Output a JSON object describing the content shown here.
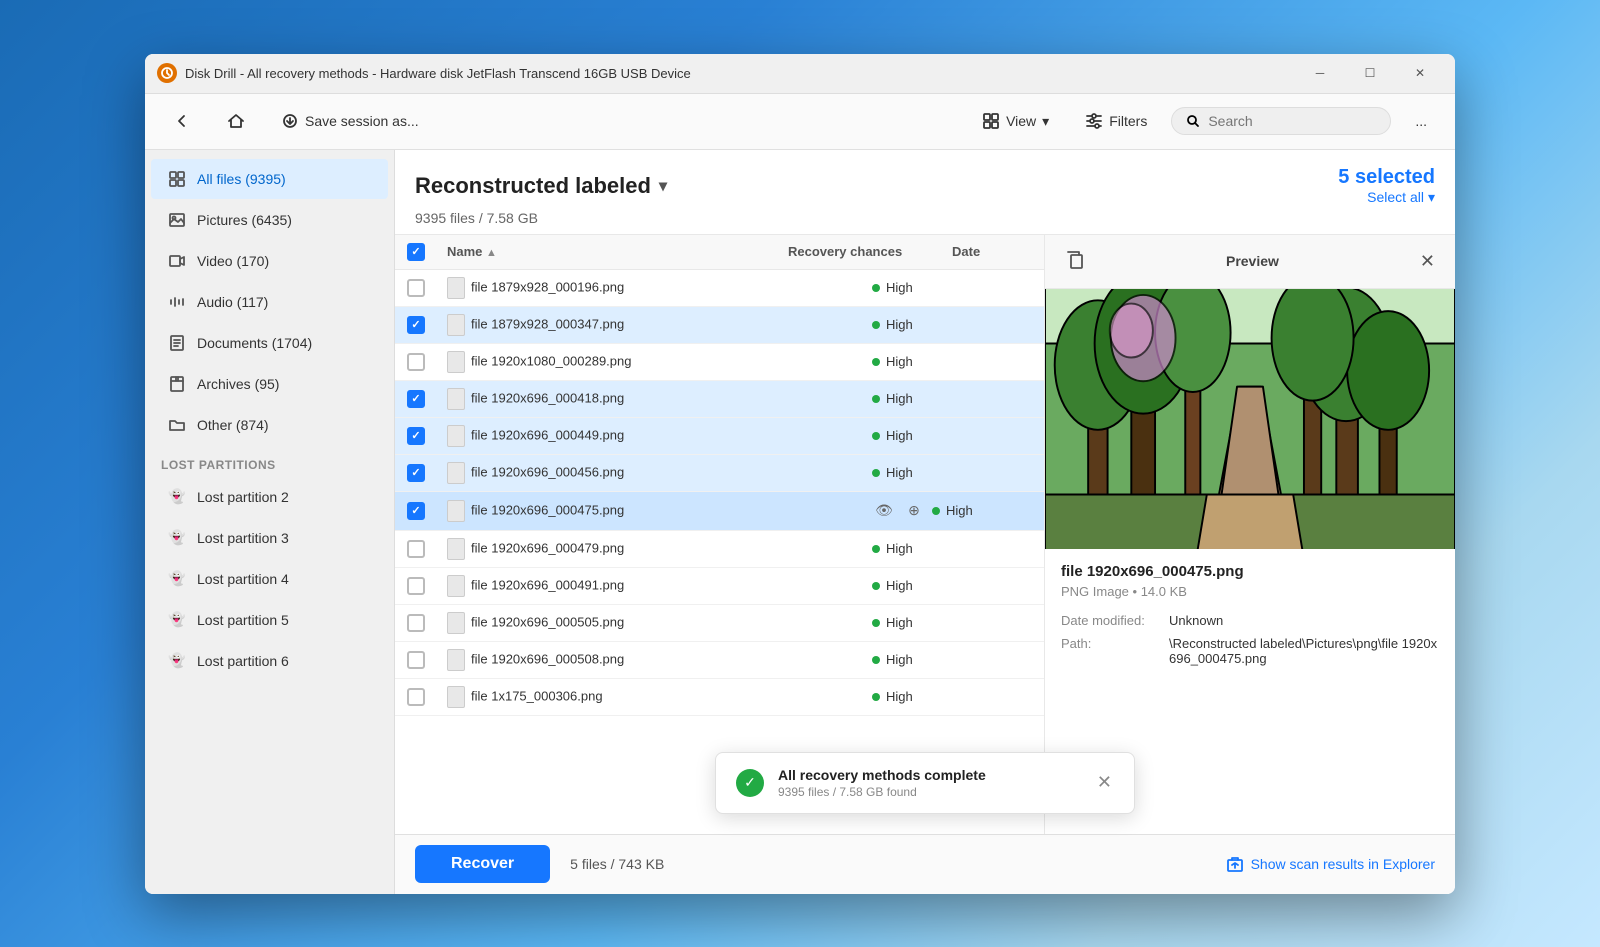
{
  "window": {
    "title": "Disk Drill - All recovery methods - Hardware disk JetFlash Transcend 16GB USB Device",
    "icon_label": "D"
  },
  "toolbar": {
    "back_label": "",
    "home_label": "",
    "save_session_label": "Save session as...",
    "view_label": "View",
    "filters_label": "Filters",
    "search_placeholder": "Search",
    "more_label": "..."
  },
  "sidebar": {
    "items": [
      {
        "label": "All files (9395)",
        "icon": "grid"
      },
      {
        "label": "Pictures (6435)",
        "icon": "pictures"
      },
      {
        "label": "Video (170)",
        "icon": "video"
      },
      {
        "label": "Audio (117)",
        "icon": "audio"
      },
      {
        "label": "Documents (1704)",
        "icon": "documents"
      },
      {
        "label": "Archives (95)",
        "icon": "archives"
      },
      {
        "label": "Other (874)",
        "icon": "other"
      }
    ],
    "lost_partitions_label": "Lost partitions",
    "lost_partitions": [
      {
        "label": "Lost partition 2"
      },
      {
        "label": "Lost partition 3"
      },
      {
        "label": "Lost partition 4"
      },
      {
        "label": "Lost partition 5"
      },
      {
        "label": "Lost partition 6"
      }
    ]
  },
  "panel": {
    "title": "Reconstructed labeled",
    "subtitle": "9395 files / 7.58 GB",
    "selected_count": "5 selected",
    "select_all_label": "Select all"
  },
  "file_list": {
    "columns": {
      "name": "Name",
      "recovery_chances": "Recovery chances",
      "date": "Date"
    },
    "files": [
      {
        "name": "file 1879x928_000196.png",
        "checked": false,
        "recovery": "High",
        "date": ""
      },
      {
        "name": "file 1879x928_000347.png",
        "checked": true,
        "recovery": "High",
        "date": ""
      },
      {
        "name": "file 1920x1080_000289.png",
        "checked": false,
        "recovery": "High",
        "date": ""
      },
      {
        "name": "file 1920x696_000418.png",
        "checked": true,
        "recovery": "High",
        "date": ""
      },
      {
        "name": "file 1920x696_000449.png",
        "checked": true,
        "recovery": "High",
        "date": ""
      },
      {
        "name": "file 1920x696_000456.png",
        "checked": true,
        "recovery": "High",
        "date": ""
      },
      {
        "name": "file 1920x696_000475.png",
        "checked": true,
        "recovery": "High",
        "date": "",
        "highlighted": true
      },
      {
        "name": "file 1920x696_000479.png",
        "checked": false,
        "recovery": "High",
        "date": ""
      },
      {
        "name": "file 1920x696_000491.png",
        "checked": false,
        "recovery": "High",
        "date": ""
      },
      {
        "name": "file 1920x696_000505.png",
        "checked": false,
        "recovery": "High",
        "date": ""
      },
      {
        "name": "file 1920x696_000508.png",
        "checked": false,
        "recovery": "High",
        "date": ""
      },
      {
        "name": "file 1x175_000306.png",
        "checked": false,
        "recovery": "High",
        "date": ""
      }
    ]
  },
  "preview": {
    "title": "Preview",
    "filename": "file 1920x696_000475.png",
    "type": "PNG Image • 14.0 KB",
    "date_modified_label": "Date modified:",
    "date_modified_value": "Unknown",
    "path_label": "Path:",
    "path_value": "\\Reconstructed labeled\\Pictures\\png\\file 1920x696_000475.png"
  },
  "toast": {
    "title": "All recovery methods complete",
    "subtitle": "9395 files / 7.58 GB found",
    "icon": "✓"
  },
  "bottom_bar": {
    "recover_label": "Recover",
    "selected_size": "5 files / 743 KB",
    "show_in_explorer_label": "Show scan results in Explorer"
  }
}
